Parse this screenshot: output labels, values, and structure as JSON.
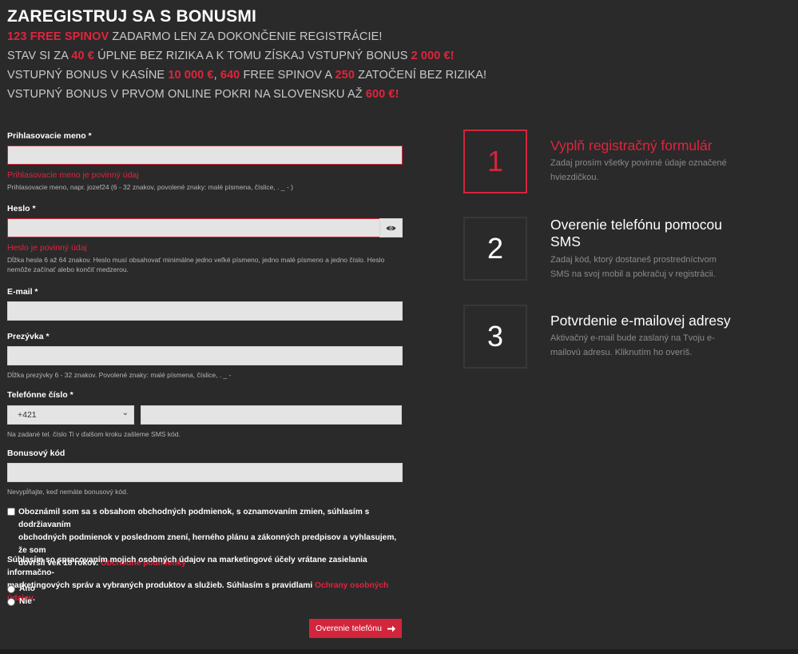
{
  "header": {
    "title": "ZAREGISTRUJ SA S BONUSMI",
    "line1": {
      "r1": "123 FREE SPINOV",
      "t1": " ZADARMO LEN ZA DOKONČENIE REGISTRÁCIE!"
    },
    "line2": {
      "t1": "STAV SI ZA ",
      "r1": "40 €",
      "t2": " ÚPLNE BEZ RIZIKA A K TOMU ZÍSKAJ VSTUPNÝ BONUS ",
      "r2": "2 000 €!"
    },
    "line3": {
      "t1": "VSTUPNÝ BONUS V KASÍNE ",
      "r1": "10 000 €",
      "t2": ", ",
      "r2": "640",
      "t3": " FREE SPINOV A ",
      "r3": "250",
      "t4": " ZATOČENÍ BEZ RIZIKA!"
    },
    "line4": {
      "t1": "VSTUPNÝ BONUS V PRVOM ONLINE POKRI NA SLOVENSKU AŽ ",
      "r1": "600 €!"
    }
  },
  "form": {
    "username": {
      "label": "Prihlasovacie meno *",
      "value": "",
      "error": "Prihlasovacie meno je povinný údaj",
      "hint": "Prihlasovacie meno, napr. jozef24 (6 - 32 znakov, povolené znaky: malé písmena, číslice, . _ - )"
    },
    "password": {
      "label": "Heslo *",
      "value": "",
      "error": "Heslo je povinný údaj",
      "hint1": "Dĺžka hesla 6 až 64 znakov. Heslo musí obsahovať minimálne jedno veľké písmeno, jedno malé písmeno a jedno číslo. Heslo",
      "hint2": "nemôže začínať alebo končiť medzerou.",
      "toggle_icon": "eye-icon"
    },
    "email": {
      "label": "E-mail *",
      "value": ""
    },
    "surname": {
      "label": "Prezývka *",
      "value": "",
      "hint": "Dĺžka prezývky 6 - 32 znakov. Povolené znaky: malé písmena, číslice, . _ -"
    },
    "phone": {
      "label": "Telefónne číslo *",
      "prefix": "+421",
      "value": "",
      "hint": "Na zadané tel. číslo Ti v ďalšom kroku zašleme SMS kód."
    },
    "bonus": {
      "label": "Bonusový kód",
      "value": "",
      "hint": "Nevypĺňajte, keď nemáte bonusový kód."
    },
    "terms": {
      "text1": "Oboznámil som sa s obsahom obchodných podmienok, s oznamovaním zmien, súhlasím s dodržiavaním",
      "text2": "obchodných podmienok v poslednom znení, herného plánu a zákonných predpisov a vyhlasujem, že som",
      "text3": "dovŕšil vek 18 rokov. ",
      "link": "Obchodné podmienky",
      "checked": false
    },
    "privacy": {
      "text1": "Súhlasím so spracovaním mojich osobných údajov na marketingové účely vrátane zasielania informačno-",
      "text2": "marketingových správ a vybraných produktov a služieb. Súhlasím s pravidlami ",
      "link": "Ochrany osobných údajov",
      "end": ".",
      "yes": "Áno",
      "no": "Nie"
    },
    "submit": {
      "label": "Overenie telefónu",
      "icon": "arrow-right-icon"
    }
  },
  "steps": [
    {
      "number": "1",
      "title": "Vyplň registračný formulár",
      "desc": "Zadaj prosím všetky povinné údaje označené hviezdičkou.",
      "active": true
    },
    {
      "number": "2",
      "title": "Overenie telefónu pomocou SMS",
      "desc": "Zadaj kód, ktorý dostaneš prostredníctvom SMS na svoj mobil a pokračuj v registrácii.",
      "active": false
    },
    {
      "number": "3",
      "title": "Potvrdenie e-mailovej adresy",
      "desc": "Aktivačný e-mail bude zaslaný na Tvoju e-mailovú adresu. Kliknutím ho overíš.",
      "active": false
    }
  ],
  "colors": {
    "accent": "#d3253b",
    "background": "#2a2a2a",
    "input": "#e4e4e4"
  }
}
